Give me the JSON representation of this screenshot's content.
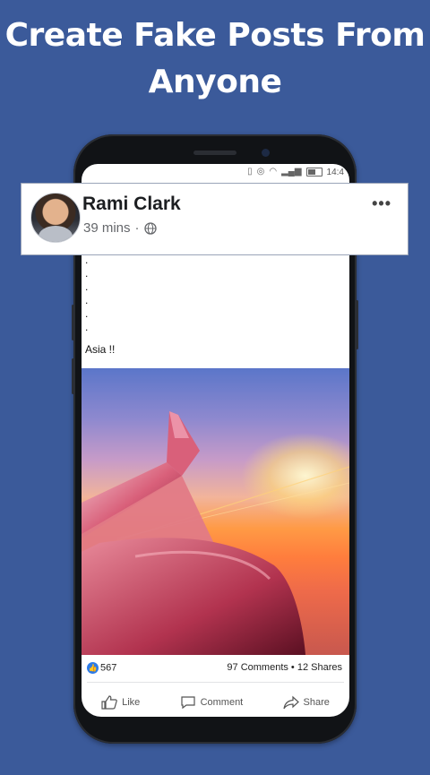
{
  "promo": {
    "line1": "Create Fake Posts From",
    "line2": "Anyone"
  },
  "status_bar": {
    "time": "14:4"
  },
  "post": {
    "author": "Rami Clark",
    "time_ago": "39 mins",
    "separator": "·",
    "privacy_icon": "globe-icon",
    "more_icon": "more-options-icon",
    "more_glyph": "•••",
    "text_dots": [
      ".",
      ".",
      ".",
      ".",
      ".",
      ".",
      "."
    ],
    "text": "Asia !!",
    "image_description_icon": "airplane-wing-photo"
  },
  "stats": {
    "likes": "567",
    "comments_shares": "97 Comments • 12 Shares"
  },
  "actions": {
    "like": "Like",
    "comment": "Comment",
    "share": "Share"
  },
  "colors": {
    "background": "#3b5a9a",
    "like_blue": "#2d7be8"
  }
}
